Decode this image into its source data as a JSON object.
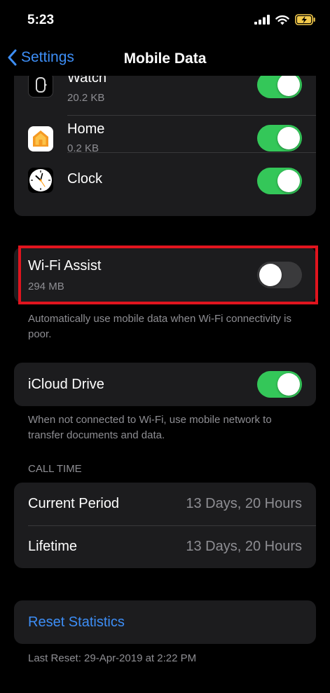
{
  "status_bar": {
    "time": "5:23"
  },
  "nav": {
    "back_label": "Settings",
    "title": "Mobile Data"
  },
  "apps": [
    {
      "name": "Watch",
      "usage": "20.2 KB",
      "enabled": true,
      "icon": "watch-icon"
    },
    {
      "name": "Home",
      "usage": "0.2 KB",
      "enabled": true,
      "icon": "home-icon"
    },
    {
      "name": "Clock",
      "usage": "",
      "enabled": true,
      "icon": "clock-icon"
    }
  ],
  "wifi_assist": {
    "title": "Wi-Fi Assist",
    "usage": "294 MB",
    "enabled": false,
    "footer": "Automatically use mobile data when Wi-Fi connectivity is poor."
  },
  "icloud_drive": {
    "title": "iCloud Drive",
    "enabled": true,
    "footer": "When not connected to Wi-Fi, use mobile network to transfer documents and data."
  },
  "call_time": {
    "header": "CALL TIME",
    "rows": [
      {
        "label": "Current Period",
        "value": "13 Days, 20 Hours"
      },
      {
        "label": "Lifetime",
        "value": "13 Days, 20 Hours"
      }
    ]
  },
  "reset": {
    "label": "Reset Statistics",
    "last_reset": "Last Reset: 29-Apr-2019 at 2:22 PM"
  },
  "colors": {
    "accent": "#3d8ef6",
    "toggle_on": "#34c759",
    "highlight": "#e0141e"
  }
}
